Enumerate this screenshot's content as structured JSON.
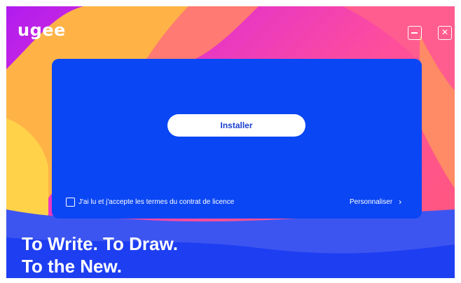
{
  "app": {
    "logo": "ugee"
  },
  "window": {
    "minimize_icon": "minimize-icon",
    "close_icon": "close-icon",
    "close_glyph": "✕"
  },
  "panel": {
    "install_label": "Installer",
    "license_text": "J'ai lu et j'accepte les termes du contrat de licence",
    "license_checked": false,
    "customize_label": "Personnaliser",
    "customize_icon": "chevron-right-icon",
    "chevron_glyph": "›"
  },
  "slogan": {
    "line1": "To Write. To Draw.",
    "line2": "To the New."
  },
  "colors": {
    "panel": "#0a46f4",
    "accent": "#1a3fd0"
  }
}
